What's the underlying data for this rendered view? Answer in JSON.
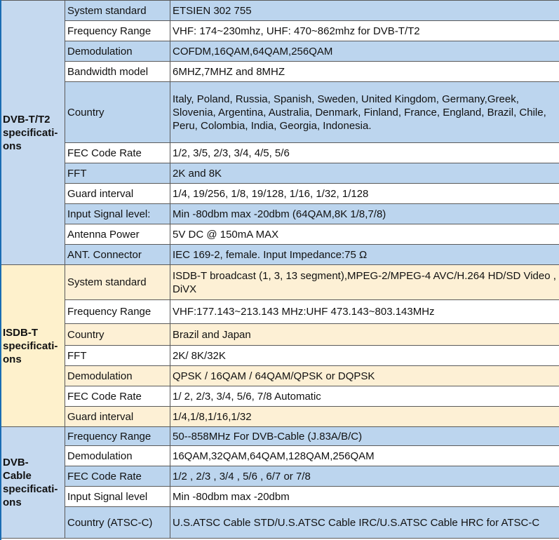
{
  "sections": [
    {
      "title": "DVB-T/T2 specifications",
      "rows": [
        {
          "label": "System standard",
          "value": "ETSIEN 302 755"
        },
        {
          "label": "Frequency Range",
          "value": "VHF: 174~230mhz, UHF: 470~862mhz for DVB-T/T2"
        },
        {
          "label": "Demodulation",
          "value": "COFDM,16QAM,64QAM,256QAM"
        },
        {
          "label": "Bandwidth model",
          "value": "6MHZ,7MHZ and 8MHZ"
        },
        {
          "label": "Country",
          "value": "Italy, Poland, Russia, Spanish, Sweden, United Kingdom, Germany,Greek, Slovenia, Argentina, Australia, Denmark, Finland, France, England, Brazil, Chile, Peru, Colombia, India, Georgia, Indonesia."
        },
        {
          "label": "FEC Code Rate",
          "value": "1/2, 3/5, 2/3, 3/4, 4/5, 5/6"
        },
        {
          "label": "FFT",
          "value": "2K and 8K"
        },
        {
          "label": "Guard interval",
          "value": "1/4, 19/256, 1/8, 19/128, 1/16, 1/32, 1/128"
        },
        {
          "label": "Input Signal level:",
          "value": "Min -80dbm max -20dbm (64QAM,8K 1/8,7/8)"
        },
        {
          "label": "Antenna Power",
          "value": "5V DC @ 150mA MAX"
        },
        {
          "label": "ANT. Connector",
          "value": "IEC 169-2, female.   Input Impedance:75 Ω"
        }
      ]
    },
    {
      "title": "ISDB-T specifications",
      "rows": [
        {
          "label": "System standard",
          "value": "ISDB-T broadcast (1, 3, 13 segment),MPEG-2/MPEG-4 AVC/H.264 HD/SD Video , DiVX"
        },
        {
          "label": "Frequency Range",
          "value": "VHF:177.143~213.143 MHz:UHF 473.143~803.143MHz"
        },
        {
          "label": "Country",
          "value": "Brazil and Japan"
        },
        {
          "label": "FFT",
          "value": "2K/ 8K/32K"
        },
        {
          "label": "Demodulation",
          "value": "QPSK / 16QAM / 64QAM/QPSK or DQPSK"
        },
        {
          "label": "FEC Code Rate",
          "value": "1/ 2, 2/3, 3/4, 5/6, 7/8 Automatic"
        },
        {
          "label": "Guard interval",
          "value": "1/4,1/8,1/16,1/32"
        }
      ]
    },
    {
      "title": "DVB-Cable specifications",
      "rows": [
        {
          "label": "Frequency Range",
          "value": "50--858MHz For DVB-Cable (J.83A/B/C)"
        },
        {
          "label": "Demodulation",
          "value": "16QAM,32QAM,64QAM,128QAM,256QAM"
        },
        {
          "label": "FEC Code Rate",
          "value": "1/2 , 2/3 , 3/4 , 5/6 , 6/7 or 7/8"
        },
        {
          "label": "Input Signal level",
          "value": "Min -80dbm max -20dbm"
        },
        {
          "label": "Country (ATSC-C)",
          "value": "U.S.ATSC Cable STD/U.S.ATSC Cable IRC/U.S.ATSC Cable HRC for ATSC-C"
        }
      ]
    }
  ]
}
